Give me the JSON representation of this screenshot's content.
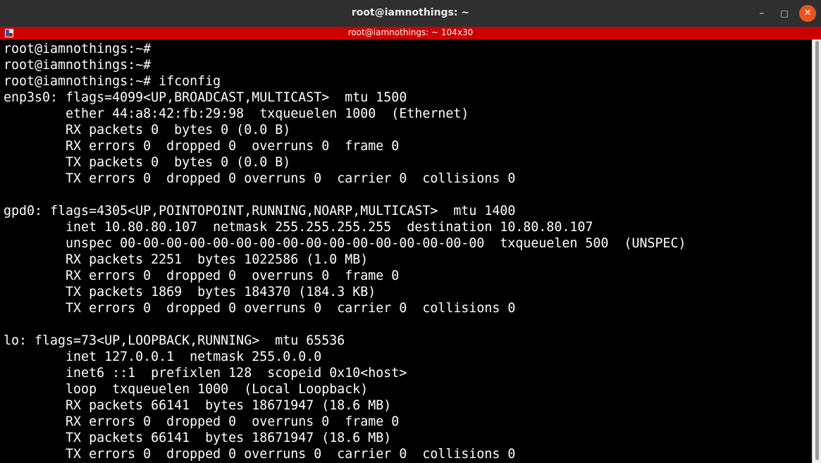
{
  "window": {
    "title": "root@iamnothings: ~",
    "controls": {
      "minimize": "–",
      "maximize": "□",
      "close": "✕"
    }
  },
  "tab": {
    "title": "root@iamnothings: ~ 104x30",
    "icon": "terminal-tab-icon"
  },
  "colors": {
    "titlebar": "#2f2f2f",
    "tabbar": "#cc0000",
    "terminal_bg": "#000000",
    "terminal_fg": "#ffffff",
    "close_button": "#e95420"
  },
  "terminal": {
    "lines": [
      "root@iamnothings:~#",
      "root@iamnothings:~#",
      "root@iamnothings:~# ifconfig",
      "enp3s0: flags=4099<UP,BROADCAST,MULTICAST>  mtu 1500",
      "        ether 44:a8:42:fb:29:98  txqueuelen 1000  (Ethernet)",
      "        RX packets 0  bytes 0 (0.0 B)",
      "        RX errors 0  dropped 0  overruns 0  frame 0",
      "        TX packets 0  bytes 0 (0.0 B)",
      "        TX errors 0  dropped 0 overruns 0  carrier 0  collisions 0",
      "",
      "gpd0: flags=4305<UP,POINTOPOINT,RUNNING,NOARP,MULTICAST>  mtu 1400",
      "        inet 10.80.80.107  netmask 255.255.255.255  destination 10.80.80.107",
      "        unspec 00-00-00-00-00-00-00-00-00-00-00-00-00-00-00-00  txqueuelen 500  (UNSPEC)",
      "        RX packets 2251  bytes 1022586 (1.0 MB)",
      "        RX errors 0  dropped 0  overruns 0  frame 0",
      "        TX packets 1869  bytes 184370 (184.3 KB)",
      "        TX errors 0  dropped 0 overruns 0  carrier 0  collisions 0",
      "",
      "lo: flags=73<UP,LOOPBACK,RUNNING>  mtu 65536",
      "        inet 127.0.0.1  netmask 255.0.0.0",
      "        inet6 ::1  prefixlen 128  scopeid 0x10<host>",
      "        loop  txqueuelen 1000  (Local Loopback)",
      "        RX packets 66141  bytes 18671947 (18.6 MB)",
      "        RX errors 0  dropped 0  overruns 0  frame 0",
      "        TX packets 66141  bytes 18671947 (18.6 MB)",
      "        TX errors 0  dropped 0 overruns 0  carrier 0  collisions 0"
    ]
  }
}
